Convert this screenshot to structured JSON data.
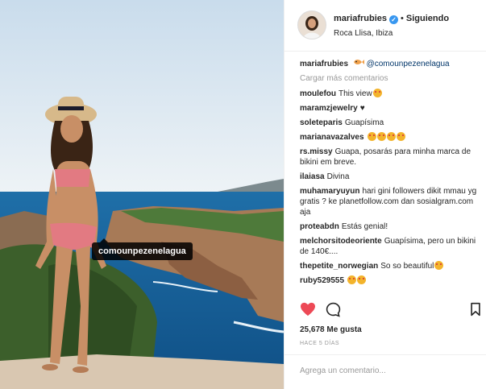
{
  "post": {
    "username": "mariafrubies",
    "dot": "•",
    "following_label": "Siguiendo",
    "location": "Roca Llisa, Ibiza",
    "photo_tag": "comounpezenelagua",
    "verified_glyph": "✓"
  },
  "caption": {
    "username": "mariafrubies",
    "mention": "@comounpezenelagua"
  },
  "load_more": "Cargar más comentarios",
  "comments": [
    {
      "user": "moulefou",
      "text": "This view",
      "emojis": 1
    },
    {
      "user": "maramzjewelry",
      "text": "♥",
      "emojis": 0
    },
    {
      "user": "soleteparis",
      "text": "Guapísima",
      "emojis": 0
    },
    {
      "user": "marianavazalves",
      "text": "",
      "emojis": 4
    },
    {
      "user": "rs.missy",
      "text": "Guapa, posarás para minha marca de bikini em breve.",
      "emojis": 0
    },
    {
      "user": "ilaiasa",
      "text": "Divina",
      "emojis": 0
    },
    {
      "user": "muhamaryuyun",
      "text": "hari gini followers dikit mmau yg gratis ? ke planetfollow.com dan sosialgram.com aja",
      "emojis": 0
    },
    {
      "user": "proteabdn",
      "text": "Estás genial!",
      "emojis": 0
    },
    {
      "user": "melchorsitodeoriente",
      "text": "Guapísima, pero un bikini de 140€....",
      "emojis": 0
    },
    {
      "user": "thepetite_norwegian",
      "text": "So so beautiful",
      "emojis": 1
    },
    {
      "user": "ruby529555",
      "text": "",
      "emojis": 2
    }
  ],
  "likes": "25,678 Me gusta",
  "time_ago": "HACE 5 DÍAS",
  "add_comment_placeholder": "Agrega un comentario...",
  "icons": {
    "like": "heart-icon",
    "comment": "comment-bubble-icon",
    "save": "bookmark-icon"
  },
  "colors": {
    "like_red": "#ed4956",
    "link_blue": "#003569",
    "verified_blue": "#3897f0"
  }
}
